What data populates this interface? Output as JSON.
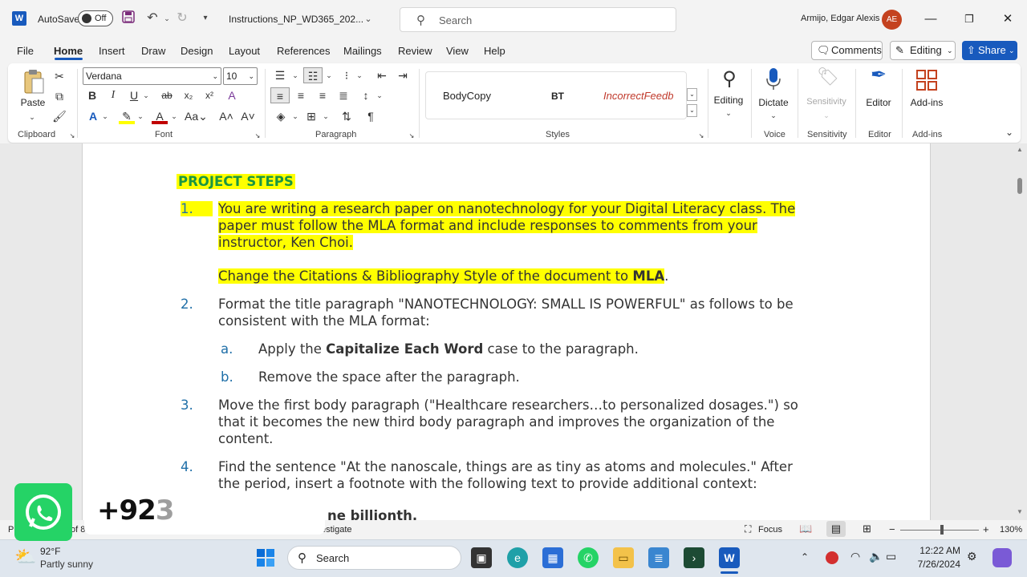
{
  "titlebar": {
    "app_logo": "W",
    "autosave_label": "AutoSave",
    "autosave_state": "Off",
    "doc_title": "Instructions_NP_WD365_202...",
    "search_placeholder": "Search",
    "user_name": "Armijo, Edgar Alexis",
    "user_initials": "AE",
    "icons": [
      "save-icon",
      "undo-icon",
      "redo-icon",
      "customize-icon",
      "minimize-icon",
      "restore-icon",
      "close-icon"
    ]
  },
  "tabs": [
    "File",
    "Home",
    "Insert",
    "Draw",
    "Design",
    "Layout",
    "References",
    "Mailings",
    "Review",
    "View",
    "Help"
  ],
  "active_tab": "Home",
  "right_buttons": {
    "comments": "Comments",
    "editing": "Editing",
    "share": "Share"
  },
  "ribbon": {
    "clipboard": {
      "paste": "Paste",
      "label": "Clipboard"
    },
    "font": {
      "name": "Verdana",
      "size": "10",
      "label": "Font"
    },
    "paragraph": {
      "label": "Paragraph"
    },
    "styles": {
      "items": [
        "BodyCopy",
        "BT",
        "IncorrectFeedb"
      ],
      "label": "Styles"
    },
    "editing": {
      "label": "Editing"
    },
    "voice": {
      "dictate": "Dictate",
      "label": "Voice"
    },
    "sensitivity": {
      "btn": "Sensitivity",
      "label": "Sensitivity"
    },
    "editor": {
      "btn": "Editor",
      "label": "Editor"
    },
    "addins": {
      "btn": "Add-ins",
      "label": "Add-ins"
    }
  },
  "document": {
    "heading": "PROJECT STEPS",
    "steps": [
      {
        "num": "1.",
        "lines": [
          "You are writing a research paper on nanotechnology for your Digital Literacy class. The",
          "paper must follow the MLA format and include responses to comments from your",
          "instructor, Ken Choi."
        ],
        "extra_pre": "Change the Citations & Bibliography Style of the document to ",
        "extra_bold": "MLA",
        "extra_post": "."
      },
      {
        "num": "2.",
        "lines": [
          "Format the title paragraph \"NANOTECHNOLOGY: SMALL IS POWERFUL\" as follows to be",
          "consistent with the MLA format:"
        ]
      },
      {
        "num": "a.",
        "pre": "Apply the ",
        "bold": "Capitalize Each Word",
        "post": " case to the paragraph."
      },
      {
        "num": "b.",
        "text": "Remove the space after the paragraph."
      },
      {
        "num": "3.",
        "lines": [
          "Move the first body paragraph (\"Healthcare researchers…to personalized dosages.\") so",
          "that it becomes the new third body paragraph and improves the organization of the",
          "content."
        ]
      },
      {
        "num": "4.",
        "lines": [
          "Find the sentence \"At the nanoscale, things are as tiny as atoms and molecules.\" After",
          "the period, insert a footnote with the following text to provide additional context:"
        ]
      }
    ],
    "partial_line": "ne billionth."
  },
  "statusbar": {
    "page_left": "P",
    "page_partial": "of 8",
    "partial_text": "estigate",
    "focus": "Focus",
    "zoom": "130%"
  },
  "taskbar": {
    "weather_temp": "92°F",
    "weather_desc": "Partly sunny",
    "search": "Search",
    "time": "12:22 AM",
    "date": "7/26/2024"
  },
  "overlay": {
    "phone_main": "+92",
    "phone_fade": "3"
  }
}
